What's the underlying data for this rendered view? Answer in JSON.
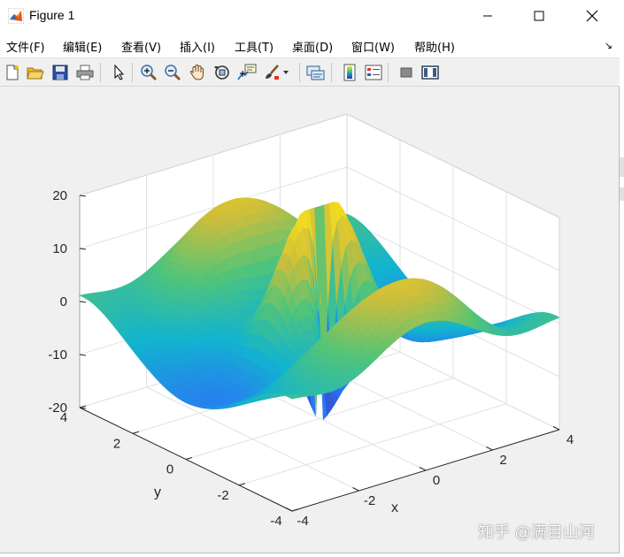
{
  "window": {
    "title": "Figure 1",
    "controls": {
      "minimize": "minimize-icon",
      "maximize": "maximize-icon",
      "close": "close-icon"
    }
  },
  "menu": {
    "items": [
      {
        "label": "文件(F)"
      },
      {
        "label": "编辑(E)"
      },
      {
        "label": "查看(V)"
      },
      {
        "label": "插入(I)"
      },
      {
        "label": "工具(T)"
      },
      {
        "label": "桌面(D)"
      },
      {
        "label": "窗口(W)"
      },
      {
        "label": "帮助(H)"
      }
    ],
    "dock_arrow": "↘"
  },
  "toolbar": {
    "icons": [
      "new-figure-icon",
      "open-file-icon",
      "save-icon",
      "print-icon",
      "edit-plot-arrow-icon",
      "zoom-in-icon",
      "zoom-out-icon",
      "pan-hand-icon",
      "rotate-3d-icon",
      "data-cursor-icon",
      "brush-icon",
      "brush-dropdown-icon",
      "link-plot-icon",
      "colorbar-icon",
      "legend-icon",
      "hide-plot-tools-icon",
      "show-plot-tools-icon"
    ]
  },
  "chart_data": {
    "type": "surface",
    "title": "",
    "xlabel": "x",
    "ylabel": "y",
    "zlabel": "",
    "xlim": [
      -4,
      4
    ],
    "ylim": [
      -4,
      4
    ],
    "zlim": [
      -20,
      20
    ],
    "x_ticks": [
      "-4",
      "-2",
      "0",
      "2",
      "4"
    ],
    "y_ticks": [
      "-4",
      "-2",
      "0",
      "2",
      "4"
    ],
    "z_ticks": [
      "-20",
      "-10",
      "0",
      "10",
      "20"
    ],
    "grid": true,
    "colormap": "parula",
    "colormap_colors": [
      "#3e26a8",
      "#2a78f4",
      "#12b4cf",
      "#52c478",
      "#cfbe3a",
      "#f9e21a"
    ],
    "surface_description": "Oscillatory radially symmetric saddle-like surface, peak ~20 at back, trough ~-20 at front"
  },
  "watermark": "知乎 @满目山河"
}
